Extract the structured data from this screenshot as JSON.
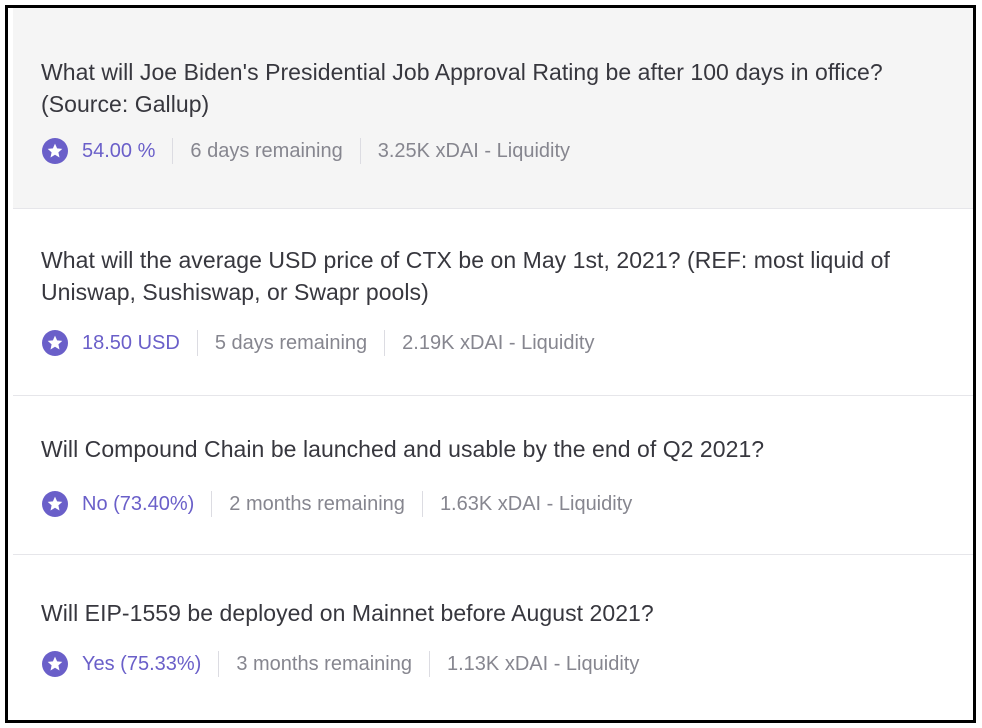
{
  "colors": {
    "accent": "#6a5fc9",
    "title_text": "#37373e",
    "muted_text": "#86868f",
    "hover_background": "#f5f5f5"
  },
  "markets": [
    {
      "title": "What will Joe Biden's Presidential Job Approval Rating be after 100 days in office? (Source: Gallup)",
      "outcome": "54.00 %",
      "remaining": "6 days remaining",
      "liquidity": "3.25K xDAI - Liquidity",
      "icon": "star-icon"
    },
    {
      "title": "What will the average USD price of CTX be on May 1st, 2021? (REF: most liquid of Uniswap, Sushiswap, or Swapr pools)",
      "outcome": "18.50 USD",
      "remaining": "5 days remaining",
      "liquidity": "2.19K xDAI - Liquidity",
      "icon": "star-icon"
    },
    {
      "title": "Will Compound Chain be launched and usable by the end of Q2 2021?",
      "outcome": "No (73.40%)",
      "remaining": "2 months remaining",
      "liquidity": "1.63K xDAI - Liquidity",
      "icon": "star-icon"
    },
    {
      "title": "Will EIP-1559 be deployed on Mainnet before August 2021?",
      "outcome": "Yes (75.33%)",
      "remaining": "3 months remaining",
      "liquidity": "1.13K xDAI - Liquidity",
      "icon": "star-icon"
    }
  ]
}
